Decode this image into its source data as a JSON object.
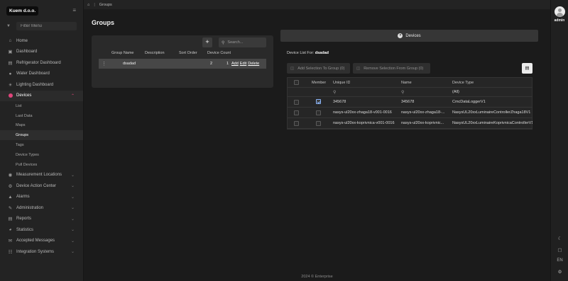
{
  "brand": "Kuem d.o.o.",
  "sidebar": {
    "filter_placeholder": "Filter Menu",
    "items": [
      {
        "label": "Home",
        "icon": "home-icon"
      },
      {
        "label": "Dashboard",
        "icon": "dashboard-icon"
      },
      {
        "label": "Refrigerator Dashboard",
        "icon": "refrigerator-icon"
      },
      {
        "label": "Water Dashboard",
        "icon": "water-icon"
      },
      {
        "label": "Lighting Dashboard",
        "icon": "lightbulb-icon"
      },
      {
        "label": "Devices",
        "icon": "devices-icon"
      }
    ],
    "sub_items": [
      "List",
      "Last Data",
      "Maps",
      "Groups",
      "Tags",
      "Device Types",
      "Pull Devices"
    ],
    "items_after": [
      {
        "label": "Measurement Locations",
        "icon": "location-icon"
      },
      {
        "label": "Device Action Center",
        "icon": "action-center-icon"
      },
      {
        "label": "Alarms",
        "icon": "bell-icon"
      },
      {
        "label": "Administration",
        "icon": "administration-icon"
      },
      {
        "label": "Reports",
        "icon": "reports-icon"
      },
      {
        "label": "Statistics",
        "icon": "statistics-icon"
      },
      {
        "label": "Accepted Messages",
        "icon": "messages-icon"
      },
      {
        "label": "Integration Systems",
        "icon": "integration-icon"
      }
    ]
  },
  "topbar": {
    "breadcrumb": "Groups"
  },
  "user": {
    "name": "admin"
  },
  "rail": {
    "language": "EN"
  },
  "page": {
    "title": "Groups"
  },
  "groups": {
    "search_placeholder": "Search...",
    "columns": [
      "Group Name",
      "Description",
      "Sort Order",
      "Device Count"
    ],
    "rows": [
      {
        "name": "dsadad",
        "description": "",
        "sort_order": "2",
        "device_count": "1",
        "actions": [
          "Add",
          "Edit",
          "Delete"
        ]
      }
    ]
  },
  "devices_panel": {
    "button_label": "Devices",
    "list_for_label": "Device List For:",
    "list_for_group": "dsadad",
    "add_selection": "Add Selection To Group (0)",
    "remove_selection": "Remove Selection From Group (0)",
    "columns": [
      "Member",
      "Unique ID",
      "Name",
      "Device Type"
    ],
    "type_filter": "(All)",
    "rows": [
      {
        "member": true,
        "unique_id": "345678",
        "name": "345678",
        "device_type": "CmcDataLoggerV1"
      },
      {
        "member": false,
        "unique_id": "nasys-ul20xx-zhaga18-v001-0016",
        "name": "nasys-ul20xx-zhaga18-...",
        "device_type": "NasysUL20xxLuminaireControllerZhaga18V1"
      },
      {
        "member": false,
        "unique_id": "nasys-ul20xx-koprivnica-v001-0016",
        "name": "nasys-ul20xx-koprivnic...",
        "device_type": "NasysUL20xxLuminaireKoprivnicaControllerV1"
      }
    ]
  },
  "footer": "2024 © Enterprise",
  "colors": {
    "accent": "#e0457b",
    "checkbox": "#8ab4f8"
  }
}
